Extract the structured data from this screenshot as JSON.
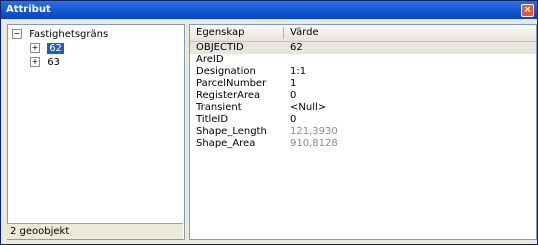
{
  "window": {
    "title": "Attribut",
    "close_glyph": "×"
  },
  "tree": {
    "root_label": "Fastighetsgräns",
    "root_expander": "−",
    "children": [
      {
        "label": "62",
        "expander": "+"
      },
      {
        "label": "63",
        "expander": "+"
      }
    ]
  },
  "status": {
    "text": "2 geoobjekt"
  },
  "table": {
    "headers": {
      "property": "Egenskap",
      "value": "Värde"
    },
    "rows": [
      {
        "key": "OBJECTID",
        "value": "62"
      },
      {
        "key": "AreID",
        "value": ""
      },
      {
        "key": "Designation",
        "value": "1:1"
      },
      {
        "key": "ParcelNumber",
        "value": "1"
      },
      {
        "key": "RegisterArea",
        "value": "0"
      },
      {
        "key": "Transient",
        "value": "<Null>"
      },
      {
        "key": "TitleID",
        "value": "0"
      },
      {
        "key": "Shape_Length",
        "value": "121,3930"
      },
      {
        "key": "Shape_Area",
        "value": "910,8128"
      }
    ]
  }
}
